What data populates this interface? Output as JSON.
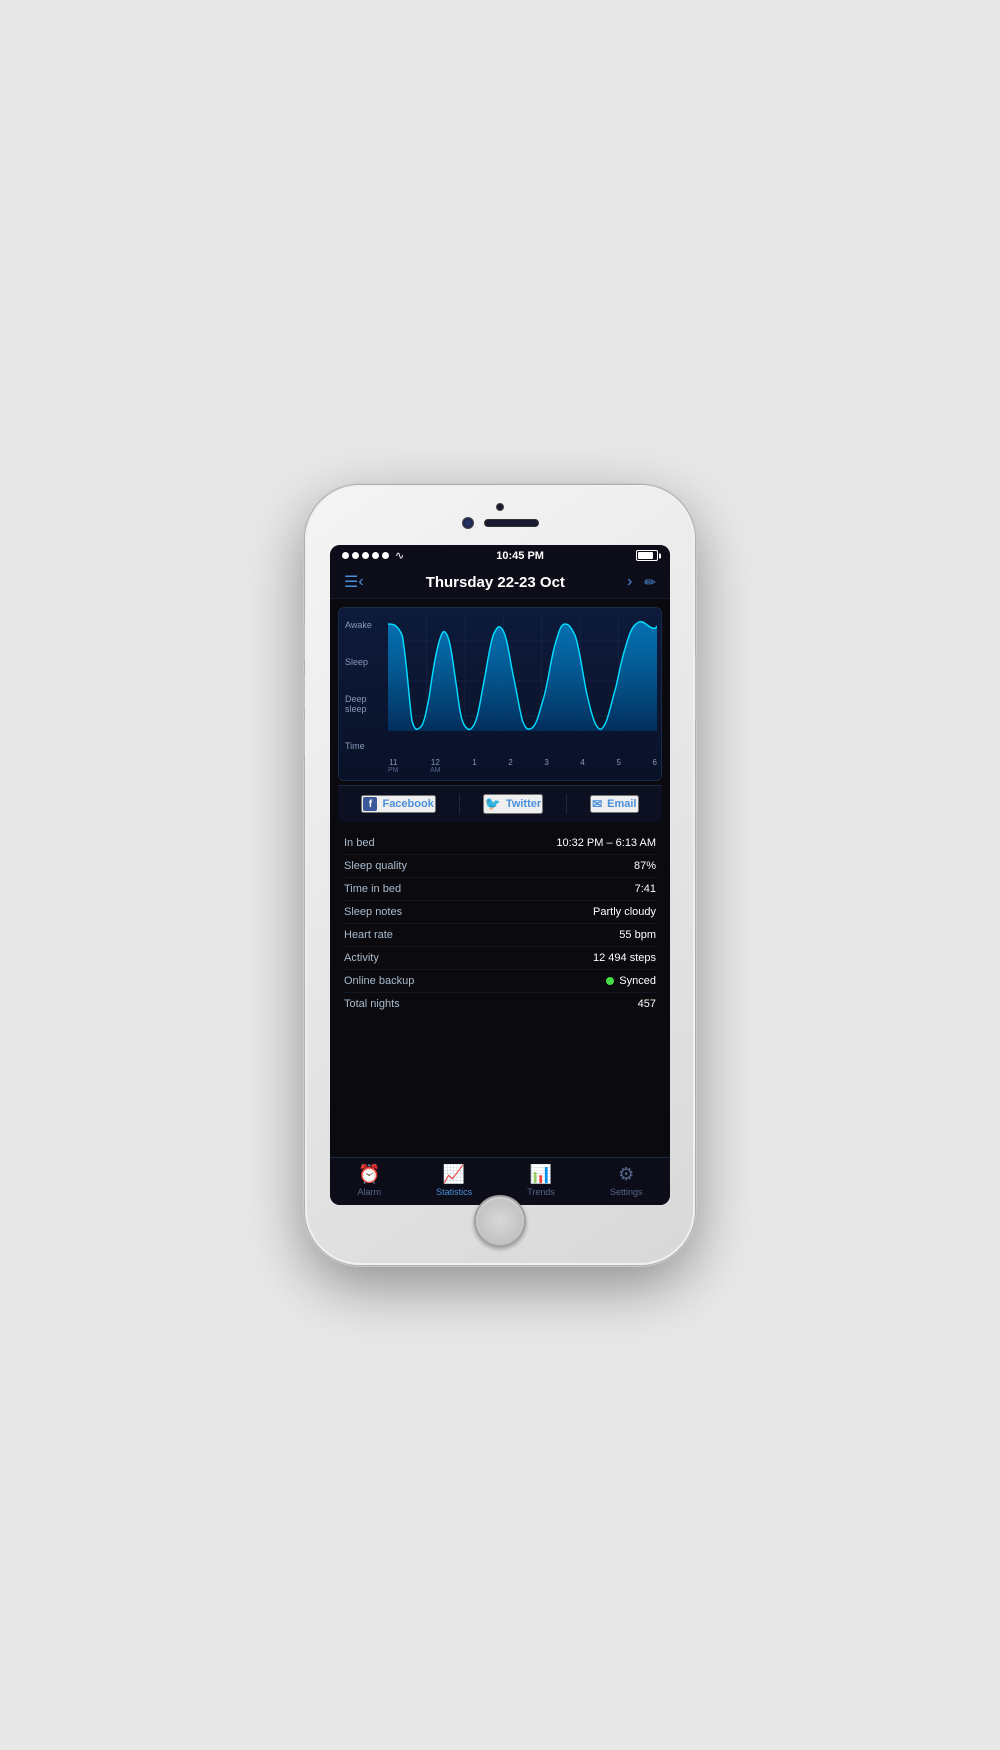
{
  "status_bar": {
    "time": "10:45 PM",
    "signal_dots": 5
  },
  "header": {
    "title": "Thursday 22-23 Oct",
    "menu_icon": "☰",
    "left_arrow": "‹",
    "right_arrow": "›",
    "edit_icon": "✏"
  },
  "chart": {
    "y_labels": [
      "Awake",
      "Sleep",
      "Deep\nsleep"
    ],
    "x_labels": [
      {
        "value": "11",
        "sub": "PM"
      },
      {
        "value": "12",
        "sub": "AM"
      },
      {
        "value": "1",
        "sub": ""
      },
      {
        "value": "2",
        "sub": ""
      },
      {
        "value": "3",
        "sub": ""
      },
      {
        "value": "4",
        "sub": ""
      },
      {
        "value": "5",
        "sub": ""
      },
      {
        "value": "6",
        "sub": ""
      }
    ],
    "time_label": "Time"
  },
  "share": {
    "facebook_label": "Facebook",
    "twitter_label": "Twitter",
    "email_label": "Email"
  },
  "stats": [
    {
      "label": "In bed",
      "value": "10:32 PM – 6:13 AM"
    },
    {
      "label": "Sleep quality",
      "value": "87%"
    },
    {
      "label": "Time in bed",
      "value": "7:41"
    },
    {
      "label": "Sleep notes",
      "value": "Partly cloudy"
    },
    {
      "label": "Heart rate",
      "value": "55 bpm"
    },
    {
      "label": "Activity",
      "value": "12 494 steps"
    },
    {
      "label": "Online backup",
      "value": "Synced",
      "has_dot": true
    },
    {
      "label": "Total nights",
      "value": "457"
    }
  ],
  "tabs": [
    {
      "label": "Alarm",
      "icon": "alarm",
      "active": false
    },
    {
      "label": "Statistics",
      "icon": "stats",
      "active": true
    },
    {
      "label": "Trends",
      "icon": "trends",
      "active": false
    },
    {
      "label": "Settings",
      "icon": "settings",
      "active": false
    }
  ]
}
